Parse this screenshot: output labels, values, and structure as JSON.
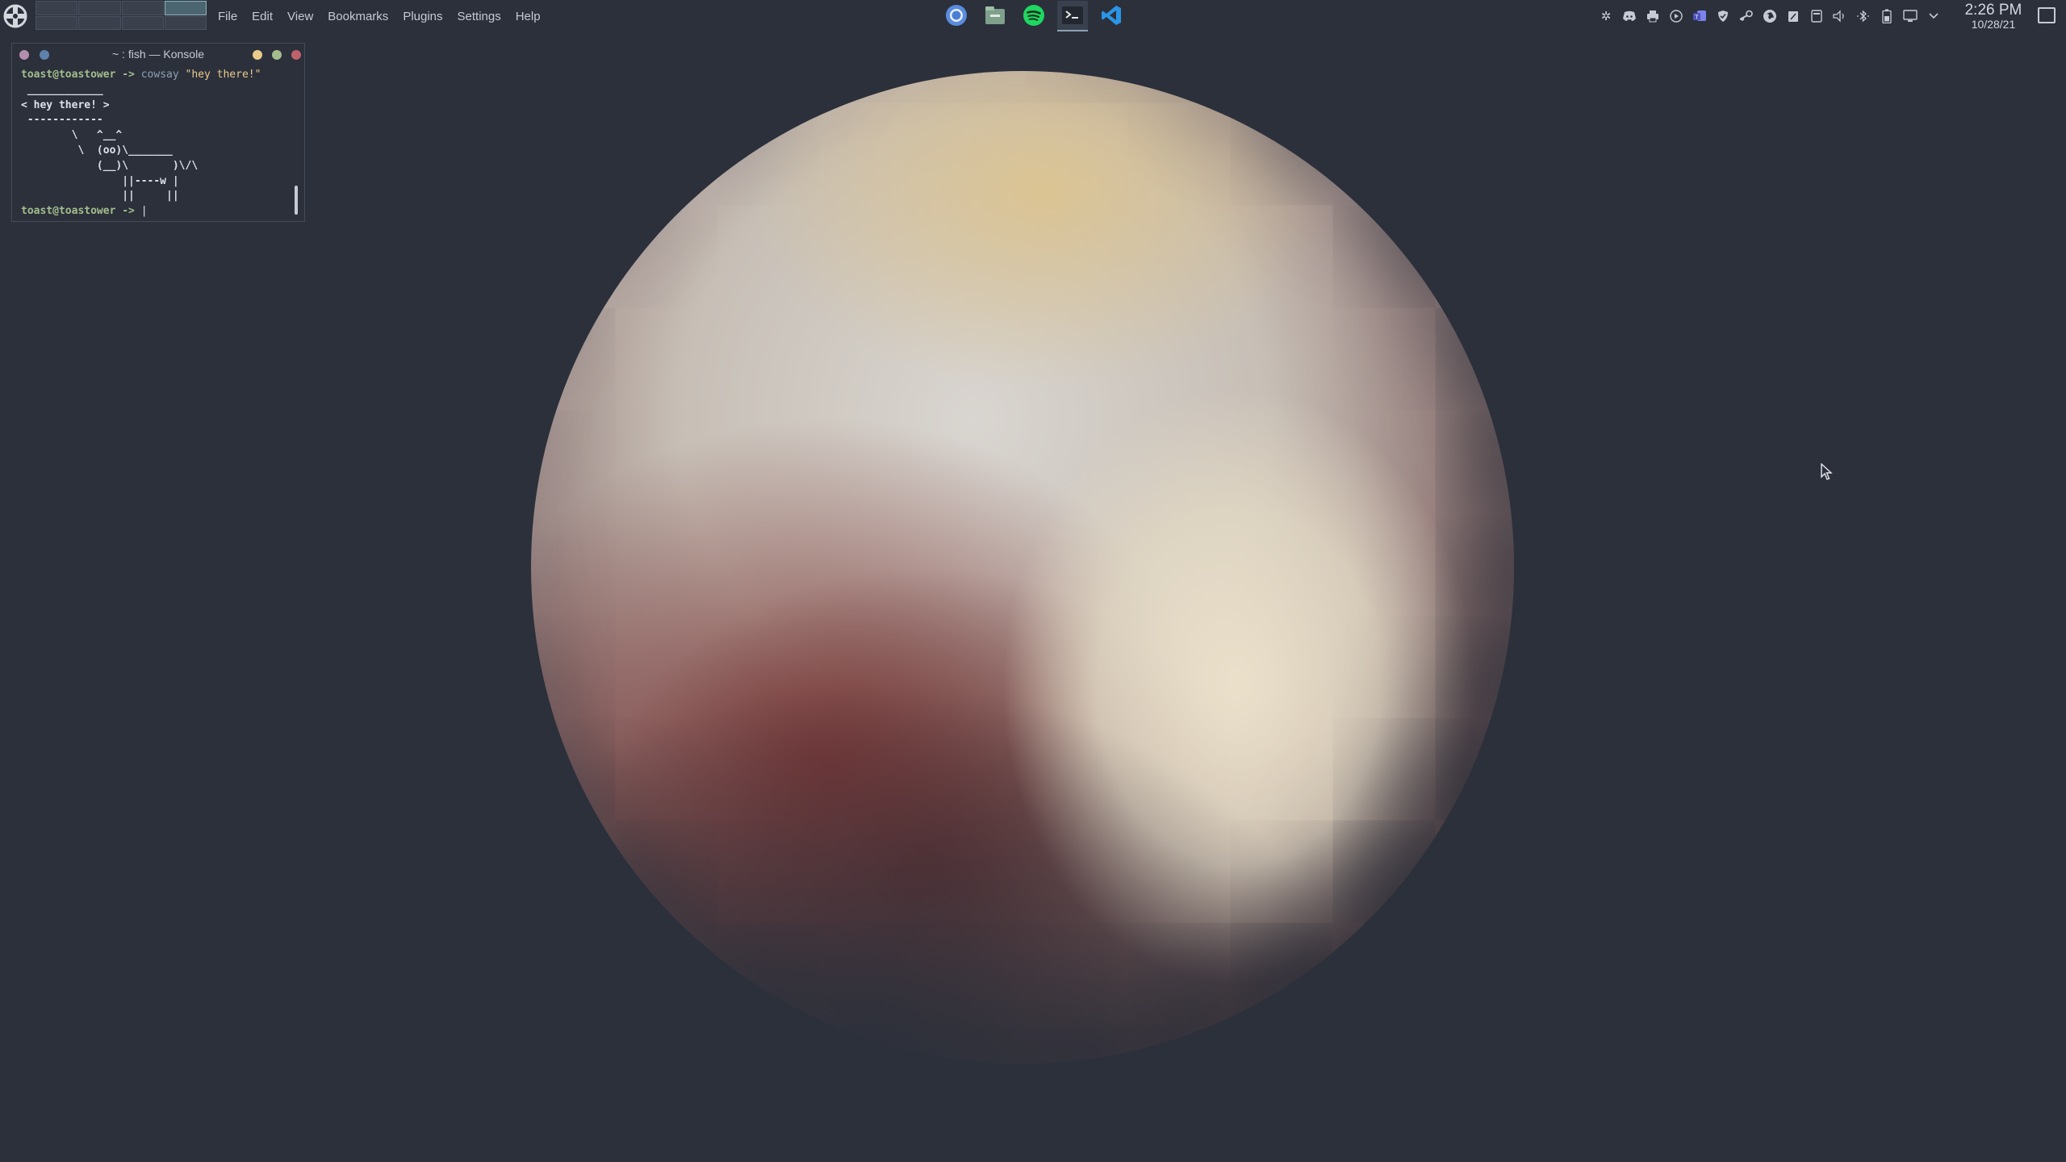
{
  "panel": {
    "menu": [
      "File",
      "Edit",
      "View",
      "Bookmarks",
      "Plugins",
      "Settings",
      "Help"
    ],
    "taskbar": [
      {
        "icon": "chromium-icon",
        "active": false
      },
      {
        "icon": "file-manager-icon",
        "active": false
      },
      {
        "icon": "spotify-icon",
        "active": false
      },
      {
        "icon": "terminal-icon",
        "active": true
      },
      {
        "icon": "vscode-icon",
        "active": false
      }
    ],
    "tray_icons": [
      "notifications-icon",
      "discord-icon",
      "printer-icon",
      "media-player-icon",
      "teams-icon",
      "vpn-shield-icon",
      "steam-icon",
      "network-globe-icon",
      "clipboard-icon",
      "storage-icon",
      "volume-icon",
      "bluetooth-icon",
      "battery-icon",
      "display-icon",
      "expand-tray-icon"
    ],
    "clock": {
      "time": "2:26 PM",
      "date": "10/28/21"
    }
  },
  "konsole": {
    "title": "~ : fish — Konsole",
    "prompt": "toast@toastower ->",
    "command": "cowsay",
    "argument": "\"hey there!\"",
    "output": [
      " ____________",
      "< hey there! >",
      " ------------",
      "        \\   ^__^",
      "         \\  (oo)\\_______",
      "            (__)\\       )\\/\\",
      "                ||----w |",
      "                ||     ||"
    ]
  },
  "colors": {
    "desktop_bg": "#2b303b",
    "prompt": "#a3be8c",
    "command": "#8fa1b3",
    "string": "#ebcb8b",
    "close": "#bf616a",
    "maximize": "#a3be8c",
    "minimize": "#ebcb8b"
  }
}
